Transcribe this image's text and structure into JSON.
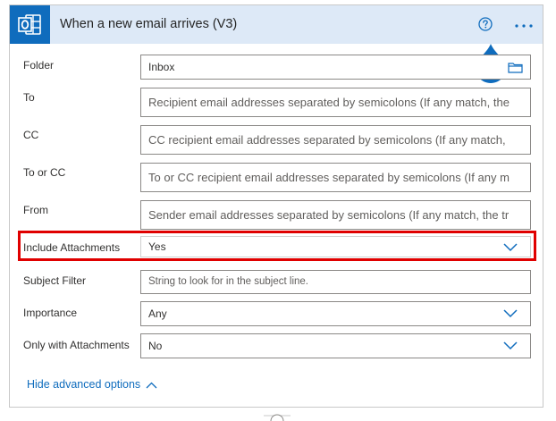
{
  "header": {
    "title": "When a new email arrives (V3)",
    "app_icon": "outlook-icon",
    "help_icon": "help-circle-icon",
    "more_icon": "ellipsis-icon"
  },
  "fields": {
    "folder": {
      "label": "Folder",
      "value": "Inbox"
    },
    "to": {
      "label": "To",
      "placeholder": "Recipient email addresses separated by semicolons (If any match, the"
    },
    "cc": {
      "label": "CC",
      "placeholder": "CC recipient email addresses separated by semicolons (If any match,"
    },
    "to_or_cc": {
      "label": "To or CC",
      "placeholder": "To or CC recipient email addresses separated by semicolons (If any m"
    },
    "from": {
      "label": "From",
      "placeholder": "Sender email addresses separated by semicolons (If any match, the tr"
    },
    "include_attachments": {
      "label": "Include Attachments",
      "value": "Yes"
    },
    "subject_filter": {
      "label": "Subject Filter",
      "placeholder": "String to look for in the subject line."
    },
    "importance": {
      "label": "Importance",
      "value": "Any"
    },
    "only_with_attachments": {
      "label": "Only with Attachments",
      "value": "No"
    }
  },
  "footer": {
    "hide_advanced": "Hide advanced options"
  },
  "colors": {
    "header_bg": "#dde9f7",
    "brand": "#0f6cbd",
    "highlight": "#e00000"
  }
}
